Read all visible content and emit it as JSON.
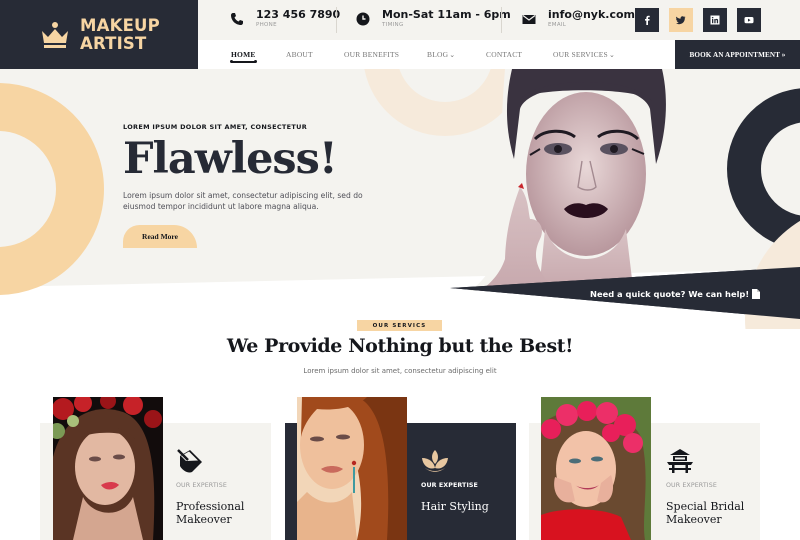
{
  "brand": {
    "name_line1": "MAKEUP",
    "name_line2": "ARTIST",
    "logo_icon": "crown-icon"
  },
  "colors": {
    "dark": "#272b36",
    "accent": "#f7d5a3",
    "cream": "#f4f3ef",
    "light_accent": "#f6eadb"
  },
  "contact": [
    {
      "icon": "phone-icon",
      "value": "123 456 7890",
      "label": "PHONE"
    },
    {
      "icon": "clock-icon",
      "value": "Mon-Sat 11am - 6pm",
      "label": "TIMING"
    },
    {
      "icon": "envelope-icon",
      "value": "info@nyk.com",
      "label": "EMAIL"
    }
  ],
  "social": [
    {
      "icon": "facebook-icon",
      "name": "Facebook"
    },
    {
      "icon": "twitter-icon",
      "name": "Twitter"
    },
    {
      "icon": "linkedin-icon",
      "name": "LinkedIn"
    },
    {
      "icon": "youtube-icon",
      "name": "YouTube"
    }
  ],
  "nav": {
    "items": [
      {
        "label": "HOME",
        "active": true
      },
      {
        "label": "ABOUT"
      },
      {
        "label": "OUR BENEFITS"
      },
      {
        "label": "BLOG",
        "dropdown": true
      },
      {
        "label": "CONTACT"
      },
      {
        "label": "OUR SERVICES",
        "dropdown": true
      }
    ],
    "cta": "BOOK AN APPOINTMENT »"
  },
  "hero": {
    "eyebrow": "LOREM IPSUM DOLOR SIT AMET, CONSECTETUR",
    "title": "Flawless!",
    "text": "Lorem ipsum dolor sit amet, consectetur adipiscing elit, sed do eiusmod tempor incididunt ut labore magna aliqua.",
    "button": "Read More",
    "quote": "Need a quick quote? We can help!"
  },
  "services": {
    "tag": "OUR SERVICS",
    "title": "We Provide Nothing but the Best!",
    "subtitle": "Lorem ipsum dolor sit amet, consectetur adipiscing elit",
    "cards": [
      {
        "eyebrow": "OUR EXPERTISE",
        "title": "Professional Makeover",
        "icon": "paint-bucket-icon",
        "theme": "light"
      },
      {
        "eyebrow": "OUR EXPERTISE",
        "title": "Hair Styling",
        "icon": "lotus-icon",
        "theme": "dark"
      },
      {
        "eyebrow": "OUR EXPERTISE",
        "title": "Special Bridal Makeover",
        "icon": "pagoda-icon",
        "theme": "light"
      }
    ]
  }
}
